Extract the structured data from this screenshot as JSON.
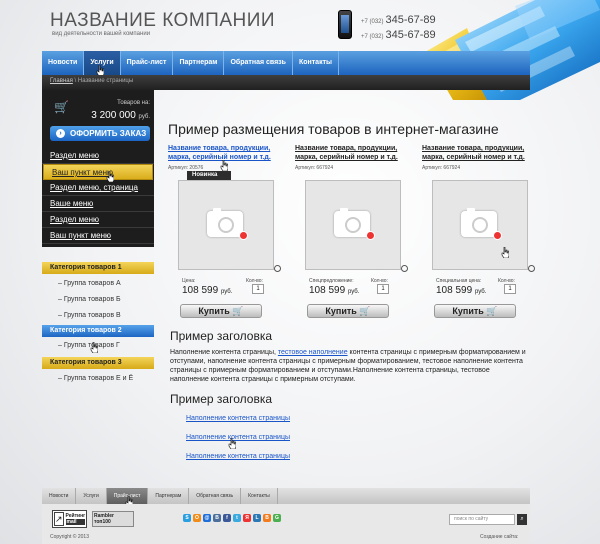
{
  "header": {
    "company": "НАЗВАНИЕ КОМПАНИИ",
    "tagline": "вид деятельности вашей компании",
    "phones": [
      {
        "code": "+7 (032)",
        "number": "345-67-89"
      },
      {
        "code": "+7 (032)",
        "number": "345-67-89"
      }
    ]
  },
  "nav": {
    "items": [
      "Новости",
      "Услуги",
      "Прайс-лист",
      "Партнерам",
      "Обратная связь",
      "Контакты"
    ],
    "active": "Услуги"
  },
  "breadcrumbs": {
    "home": "Главная",
    "separator": "\\",
    "current": "Название страницы"
  },
  "cart": {
    "label": "Товаров на:",
    "sum": "3 200 000",
    "currency": "руб.",
    "order_button": "ОФОРМИТЬ ЗАКАЗ"
  },
  "menu": {
    "items": [
      "Раздел меню",
      "Ваш пункт меню",
      "Раздел меню, страница",
      "Ваше меню",
      "Раздел меню",
      "Ваш пункт меню"
    ],
    "active_index": 1
  },
  "categories": [
    {
      "title": "Категория товаров 1",
      "items": [
        "Группа товаров А",
        "Группа товаров Б",
        "Группа товаров В"
      ]
    },
    {
      "title": "Категория товаров 2",
      "items": [
        "Группа товаров Г"
      ]
    },
    {
      "title": "Категория товаров 3",
      "items": [
        "Группа товаров Е и Ё"
      ]
    }
  ],
  "main": {
    "title": "Пример размещения товаров в интернет-магазине",
    "products": [
      {
        "name": "Название товара, продукции, марка, серийный номер и т.д.",
        "sku": "Артикул: 20576",
        "badge": "Новинка",
        "price_label": "Цена:",
        "price": "108 599",
        "currency": "руб.",
        "qty_label": "Кол-во:",
        "qty": "1",
        "buy": "Купить"
      },
      {
        "name": "Название товара, продукции, марка, серийный номер и т.д.",
        "sku": "Артикул: 667924",
        "badge": "",
        "price_label": "Спецпредложение:",
        "price": "108 599",
        "currency": "руб.",
        "qty_label": "Кол-во:",
        "qty": "1",
        "buy": "Купить"
      },
      {
        "name": "Название товара, продукции, марка, серийный номер и т.д.",
        "sku": "Артикул: 667924",
        "badge": "",
        "price_label": "Специальная цена:",
        "price": "108 599",
        "currency": "руб.",
        "qty_label": "Кол-во:",
        "qty": "1",
        "buy": "Купить"
      }
    ],
    "heading1": "Пример заголовка",
    "para_before": "Наполнение контента страницы, ",
    "para_link": "тестовое наполнение",
    "para_after": " контента страницы с примерным форматированием и отступами,  наполнение контента страницы с примерным форматированием, тестовое наполнение контента страницы с примерным форматированием и отступами.Наполнение контента страницы, тестовое наполнение контента страницы с примерным  отступами.",
    "heading2": "Пример заголовка",
    "links": [
      "Наполнение контента страницы",
      "Наполнение контента страницы",
      "Наполнение контента страницы"
    ]
  },
  "footer": {
    "nav": [
      "Новости",
      "Услуги",
      "Прайс-лист",
      "Партнерам",
      "Обратная связь",
      "Контакты"
    ],
    "active": "Прайс-лист",
    "badge1": {
      "line1": "Рейтинг",
      "line2": "mail"
    },
    "badge2": {
      "line1": "Rambler",
      "line2": "топ100"
    },
    "socials": [
      {
        "icon": "skype-icon",
        "glyph": "S",
        "color": "#2a9fe0"
      },
      {
        "icon": "odnoklassniki-icon",
        "glyph": "О",
        "color": "#f08c1a"
      },
      {
        "icon": "mail-icon",
        "glyph": "@",
        "color": "#1e6fd9"
      },
      {
        "icon": "vk-icon",
        "glyph": "В",
        "color": "#4b6f9a"
      },
      {
        "icon": "facebook-icon",
        "glyph": "f",
        "color": "#3b5998"
      },
      {
        "icon": "twitter-icon",
        "glyph": "t",
        "color": "#39a9e0"
      },
      {
        "icon": "yandex-icon",
        "glyph": "Я",
        "color": "#e33"
      },
      {
        "icon": "livejournal-icon",
        "glyph": "L",
        "color": "#2b79b5"
      },
      {
        "icon": "blogger-icon",
        "glyph": "B",
        "color": "#f37b1d"
      },
      {
        "icon": "google-icon",
        "glyph": "G",
        "color": "#4caf50"
      }
    ],
    "search_placeholder": "поиск по сайту",
    "copyright": "Copyright © 2013",
    "created": "Создание сайта:"
  }
}
